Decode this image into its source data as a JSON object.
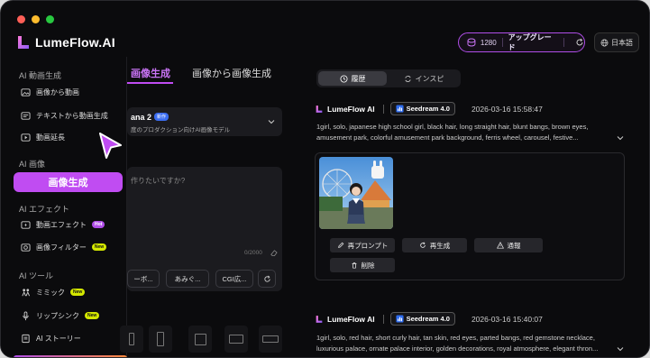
{
  "app": {
    "name": "LumeFlow.AI",
    "credits": "1280",
    "upgrade_label": "アップグレード",
    "language": "日本語",
    "accent_color": "#c04cf2"
  },
  "sidebar": {
    "sections": [
      {
        "title": "AI 動画生成",
        "items": [
          {
            "label": "画像から動画",
            "icon": "image-video-icon"
          },
          {
            "label": "テキストから動画生成",
            "icon": "text-video-icon"
          },
          {
            "label": "動画延長",
            "icon": "video-extend-icon"
          }
        ]
      },
      {
        "title": "AI 画像",
        "items": [
          {
            "label": "画像生成",
            "icon": "image-gen-icon",
            "active": true
          }
        ]
      },
      {
        "title": "AI エフェクト",
        "items": [
          {
            "label": "動画エフェクト",
            "badge": "Hot"
          },
          {
            "label": "画像フィルター",
            "badge": "New"
          }
        ]
      },
      {
        "title": "AI ツール",
        "items": [
          {
            "label": "ミミック",
            "badge": "New"
          },
          {
            "label": "リップシンク",
            "badge": "New"
          },
          {
            "label": "AI ストーリー"
          }
        ]
      }
    ]
  },
  "generator": {
    "tabs": [
      "画像生成",
      "画像から画像生成"
    ],
    "model_name": "ana 2",
    "model_badge": "新作",
    "model_desc": "度のプロダクション向けAI画像モデル",
    "prompt_placeholder": "作りたいですか?",
    "prompt_count": "0/2000",
    "chips": [
      "ーボ...",
      "あみぐ...",
      "CGI広..."
    ]
  },
  "history": {
    "tab_history": "履歴",
    "tab_inspire": "インスピ",
    "entries": [
      {
        "brand": "LumeFlow AI",
        "model": "Seedream 4.0",
        "timestamp": "2026-03-16 15:58:47",
        "prompt": "1girl, solo, japanese high school girl, black hair, long straight hair, blunt bangs, brown eyes,",
        "prompt2": "amusement park, colorful amusement park background, ferris wheel, carousel, festive..."
      },
      {
        "brand": "LumeFlow AI",
        "model": "Seedream 4.0",
        "timestamp": "2026-03-16 15:40:07",
        "prompt": "1girl, solo, red hair, short curly hair, tan skin, red eyes, parted bangs, red gemstone necklace,",
        "prompt2": "luxurious palace, ornate palace interior, golden decorations, royal atmosphere, elegant thron..."
      }
    ],
    "actions": {
      "reprompt": "再プロンプト",
      "regenerate": "再生成",
      "report": "通報",
      "delete": "削除"
    }
  }
}
